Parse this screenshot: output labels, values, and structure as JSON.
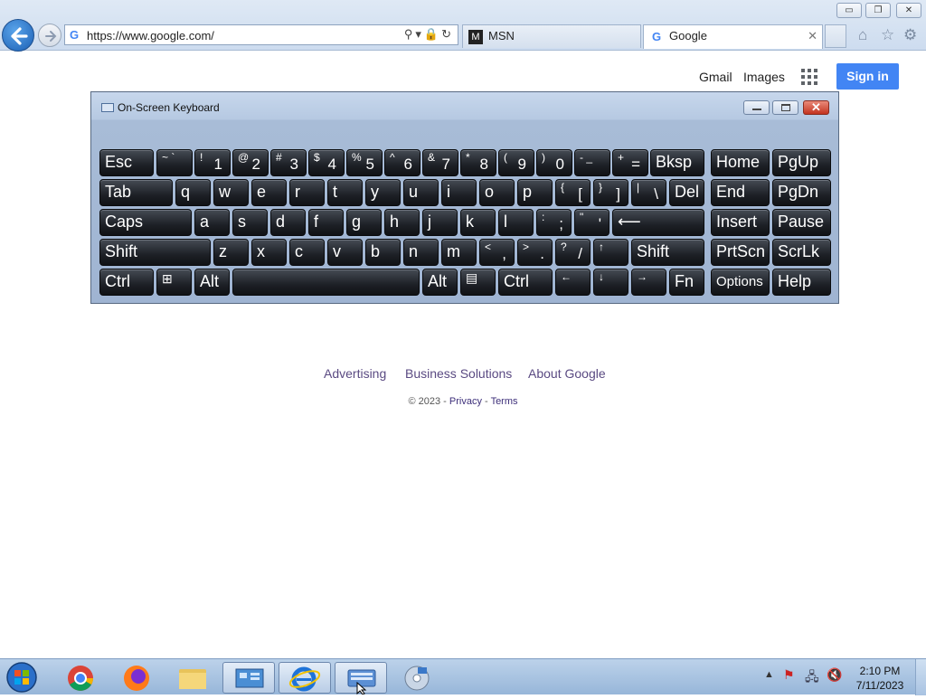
{
  "browser": {
    "url": "https://www.google.com/",
    "tabs": [
      {
        "title": "MSN"
      },
      {
        "title": "Google"
      }
    ],
    "window_controls": {
      "minimize": "▭",
      "restore": "❐",
      "close": "✕"
    }
  },
  "google": {
    "header_links": [
      "Gmail",
      "Images"
    ],
    "sign_in": "Sign in",
    "footer_links": [
      "Advertising",
      "Business Solutions",
      "About Google"
    ],
    "copyright": "© 2023 -",
    "privacy": "Privacy",
    "sep": "-",
    "terms": "Terms"
  },
  "osk": {
    "title": "On-Screen Keyboard",
    "keys": {
      "row1": {
        "esc": "Esc",
        "tilde_s": "~ `",
        "k1s": "!",
        "k1": "1",
        "k2s": "@",
        "k2": "2",
        "k3s": "#",
        "k3": "3",
        "k4s": "$",
        "k4": "4",
        "k5s": "%",
        "k5": "5",
        "k6s": "^",
        "k6": "6",
        "k7s": "&",
        "k7": "7",
        "k8s": "*",
        "k8": "8",
        "k9s": "(",
        "k9": "9",
        "k0s": ")",
        "k0": "0",
        "minus_s": "- _",
        "plus_s": "+",
        "plus": "=",
        "bksp": "Bksp",
        "home": "Home",
        "pgup": "PgUp"
      },
      "row2": {
        "tab": "Tab",
        "q": "q",
        "w": "w",
        "e": "e",
        "r": "r",
        "t": "t",
        "y": "y",
        "u": "u",
        "i": "i",
        "o": "o",
        "p": "p",
        "lbr_s": "{",
        "lbr": "[",
        "rbr_s": "}",
        "rbr": "]",
        "bs_s": "|",
        "bs": "\\",
        "del": "Del",
        "end": "End",
        "pgdn": "PgDn"
      },
      "row3": {
        "caps": "Caps",
        "a": "a",
        "s": "s",
        "d": "d",
        "f": "f",
        "g": "g",
        "h": "h",
        "j": "j",
        "k": "k",
        "l": "l",
        "semi_s": ":",
        "semi": ";",
        "quote_s": "\"",
        "quote": "'",
        "enter": "⟵",
        "insert": "Insert",
        "pause": "Pause"
      },
      "row4": {
        "lshift": "Shift",
        "z": "z",
        "x": "x",
        "c": "c",
        "v": "v",
        "b": "b",
        "n": "n",
        "m": "m",
        "comma_s": "<",
        "comma": ",",
        "period_s": ">",
        "period": ".",
        "slash_s": "?",
        "slash": "/",
        "up": "↑",
        "rshift": "Shift",
        "prtscn": "PrtScn",
        "scrlk": "ScrLk"
      },
      "row5": {
        "lctrl": "Ctrl",
        "win": "⊞",
        "lalt": "Alt",
        "ralt": "Alt",
        "menu": "▤",
        "rctrl": "Ctrl",
        "left": "←",
        "down": "↓",
        "right": "→",
        "fn": "Fn",
        "options": "Options",
        "help": "Help"
      }
    }
  },
  "taskbar": {
    "time": "2:10 PM",
    "date": "7/11/2023"
  },
  "colors": {
    "google_blue": "#4285f4",
    "link_purple": "#5a4a82"
  }
}
